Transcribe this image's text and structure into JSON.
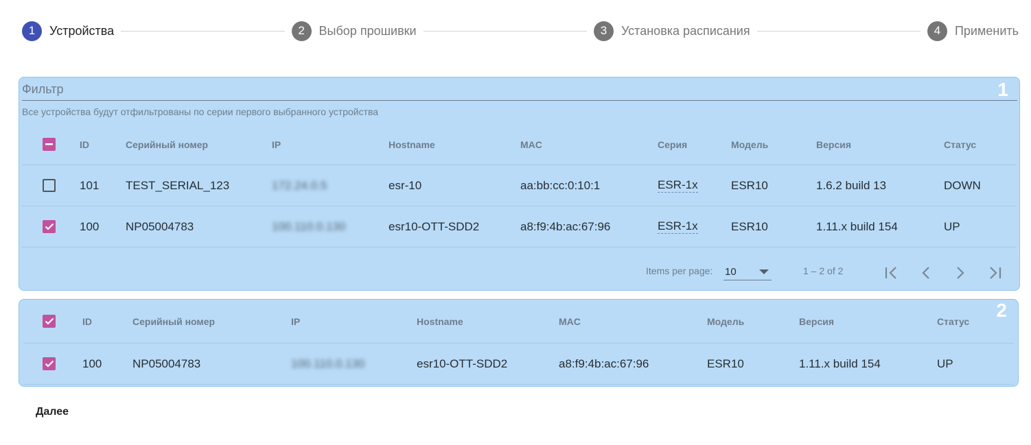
{
  "stepper": {
    "steps": [
      {
        "number": "1",
        "label": "Устройства",
        "active": true
      },
      {
        "number": "2",
        "label": "Выбор прошивки",
        "active": false
      },
      {
        "number": "3",
        "label": "Установка расписания",
        "active": false
      },
      {
        "number": "4",
        "label": "Применить",
        "active": false
      }
    ]
  },
  "panel1": {
    "number": "1",
    "filter_label": "Фильтр",
    "hint": "Все устройства будут отфильтрованы по серии первого выбранного устройства",
    "columns": [
      "ID",
      "Серийный номер",
      "IP",
      "Hostname",
      "MAC",
      "Серия",
      "Модель",
      "Версия",
      "Статус"
    ],
    "rows": [
      {
        "checked": false,
        "id": "101",
        "serial": "TEST_SERIAL_123",
        "ip": "172.24.0.5",
        "hostname": "esr-10",
        "mac": "aa:bb:cc:0:10:1",
        "series": "ESR-1x",
        "model": "ESR10",
        "version": "1.6.2 build 13",
        "status": "DOWN"
      },
      {
        "checked": true,
        "id": "100",
        "serial": "NP05004783",
        "ip": "100.110.0.130",
        "hostname": "esr10-OTT-SDD2",
        "mac": "a8:f9:4b:ac:67:96",
        "series": "ESR-1x",
        "model": "ESR10",
        "version": "1.11.x build 154",
        "status": "UP"
      }
    ],
    "paginator": {
      "items_per_page_label": "Items per page:",
      "page_size": "10",
      "range": "1 – 2 of 2"
    }
  },
  "panel2": {
    "number": "2",
    "columns": [
      "ID",
      "Серийный номер",
      "IP",
      "Hostname",
      "MAC",
      "Модель",
      "Версия",
      "Статус"
    ],
    "rows": [
      {
        "checked": true,
        "id": "100",
        "serial": "NP05004783",
        "ip": "100.110.0.130",
        "hostname": "esr10-OTT-SDD2",
        "mac": "a8:f9:4b:ac:67:96",
        "model": "ESR10",
        "version": "1.11.x build 154",
        "status": "UP"
      }
    ]
  },
  "actions": {
    "next_label": "Далее"
  },
  "colors": {
    "primary": "#3f51b5",
    "accent": "#c2519e",
    "panel_bg": "#b9dbf7",
    "step_inactive": "#757575"
  }
}
